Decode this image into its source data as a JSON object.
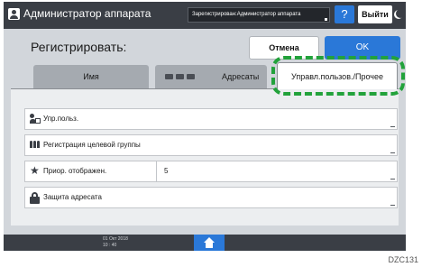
{
  "topbar": {
    "title": "Администратор аппарата",
    "login_status": "Зарегистрирован:Администратор аппарата",
    "help_label": "?",
    "logout_label": "Выйти"
  },
  "header": {
    "title": "Регистрировать:",
    "cancel_label": "Отмена",
    "ok_label": "OK"
  },
  "tabs": [
    {
      "label": "Имя",
      "selected": false
    },
    {
      "label": "Адресаты",
      "selected": false
    },
    {
      "label": "Управл.пользов./Прочее",
      "selected": true
    }
  ],
  "rows": [
    {
      "label": "Упр.польз.",
      "icon": "user-code-icon"
    },
    {
      "label": "Регистрация целевой группы",
      "icon": "group-icon"
    },
    {
      "label": "Приор. отображен.",
      "icon": "star-icon",
      "value": "5"
    },
    {
      "label": "Защита адресата",
      "icon": "lock-icon"
    }
  ],
  "bottombar": {
    "date": "01 Окт 2018",
    "time": "10 : 40"
  },
  "figure_code": "DZC131",
  "colors": {
    "accent_blue": "#2a78d8",
    "highlight_green": "#22a23b",
    "bar_dark": "#3a3e45"
  }
}
